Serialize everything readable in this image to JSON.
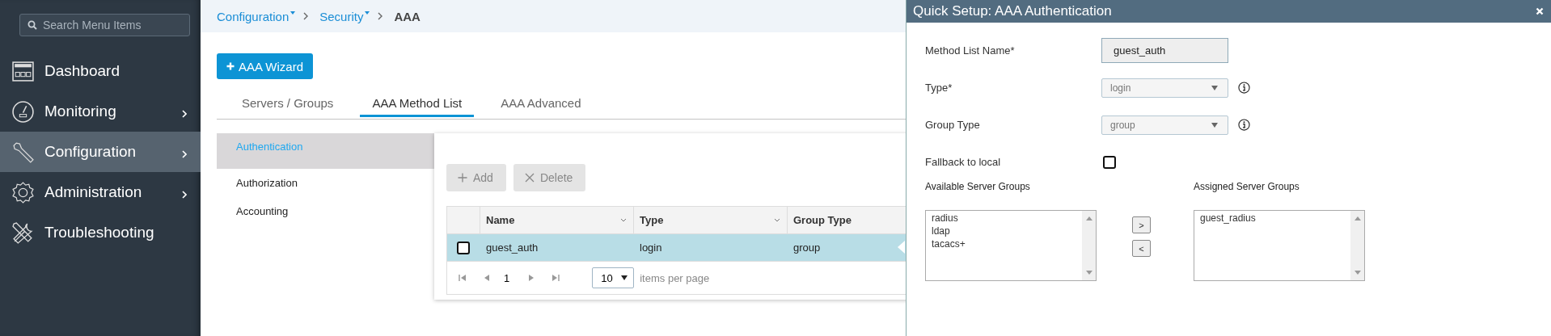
{
  "sidebar": {
    "search": {
      "placeholder": "Search Menu Items"
    },
    "items": [
      {
        "label": "Dashboard",
        "submenu": false,
        "selected": false
      },
      {
        "label": "Monitoring",
        "submenu": true,
        "selected": false
      },
      {
        "label": "Configuration",
        "submenu": true,
        "selected": true
      },
      {
        "label": "Administration",
        "submenu": true,
        "selected": false
      },
      {
        "label": "Troubleshooting",
        "submenu": false,
        "selected": false
      }
    ]
  },
  "breadcrumb": {
    "items": [
      {
        "label": "Configuration",
        "dropdown": true
      },
      {
        "label": "Security",
        "dropdown": true
      }
    ],
    "current": "AAA"
  },
  "wizard_button": {
    "label": "AAA Wizard"
  },
  "tabs": [
    {
      "label": "Servers / Groups",
      "selected": false
    },
    {
      "label": "AAA Method List",
      "selected": true
    },
    {
      "label": "AAA Advanced",
      "selected": false
    }
  ],
  "subnav": [
    {
      "label": "Authentication",
      "selected": true
    },
    {
      "label": "Authorization",
      "selected": false
    },
    {
      "label": "Accounting",
      "selected": false
    }
  ],
  "toolbar": [
    {
      "kind": "add",
      "label": "Add",
      "disabled": true
    },
    {
      "kind": "delete",
      "label": "Delete",
      "disabled": true
    }
  ],
  "table": {
    "columns": [
      "Name",
      "Type",
      "Group Type"
    ],
    "rows": [
      {
        "checked": false,
        "selected": true,
        "cells": [
          "guest_auth",
          "login",
          "group"
        ]
      }
    ]
  },
  "pager": {
    "page": "1",
    "page_size": "10",
    "label": "items per page"
  },
  "panel": {
    "title": "Quick Setup: AAA Authentication",
    "fields": [
      {
        "kind": "text",
        "label": "Method List Name*",
        "value": "guest_auth"
      },
      {
        "kind": "select",
        "label": "Type*",
        "value": "login",
        "info": true
      },
      {
        "kind": "select",
        "label": "Group Type",
        "value": "group",
        "info": true
      },
      {
        "kind": "checkbox",
        "label": "Fallback to local",
        "checked": false
      }
    ],
    "available": {
      "title": "Available Server Groups",
      "items": [
        "radius",
        "ldap",
        "tacacs+"
      ]
    },
    "move_buttons": [
      ">",
      "<"
    ],
    "assigned": {
      "title": "Assigned Server Groups",
      "items": [
        "guest_radius"
      ]
    }
  }
}
